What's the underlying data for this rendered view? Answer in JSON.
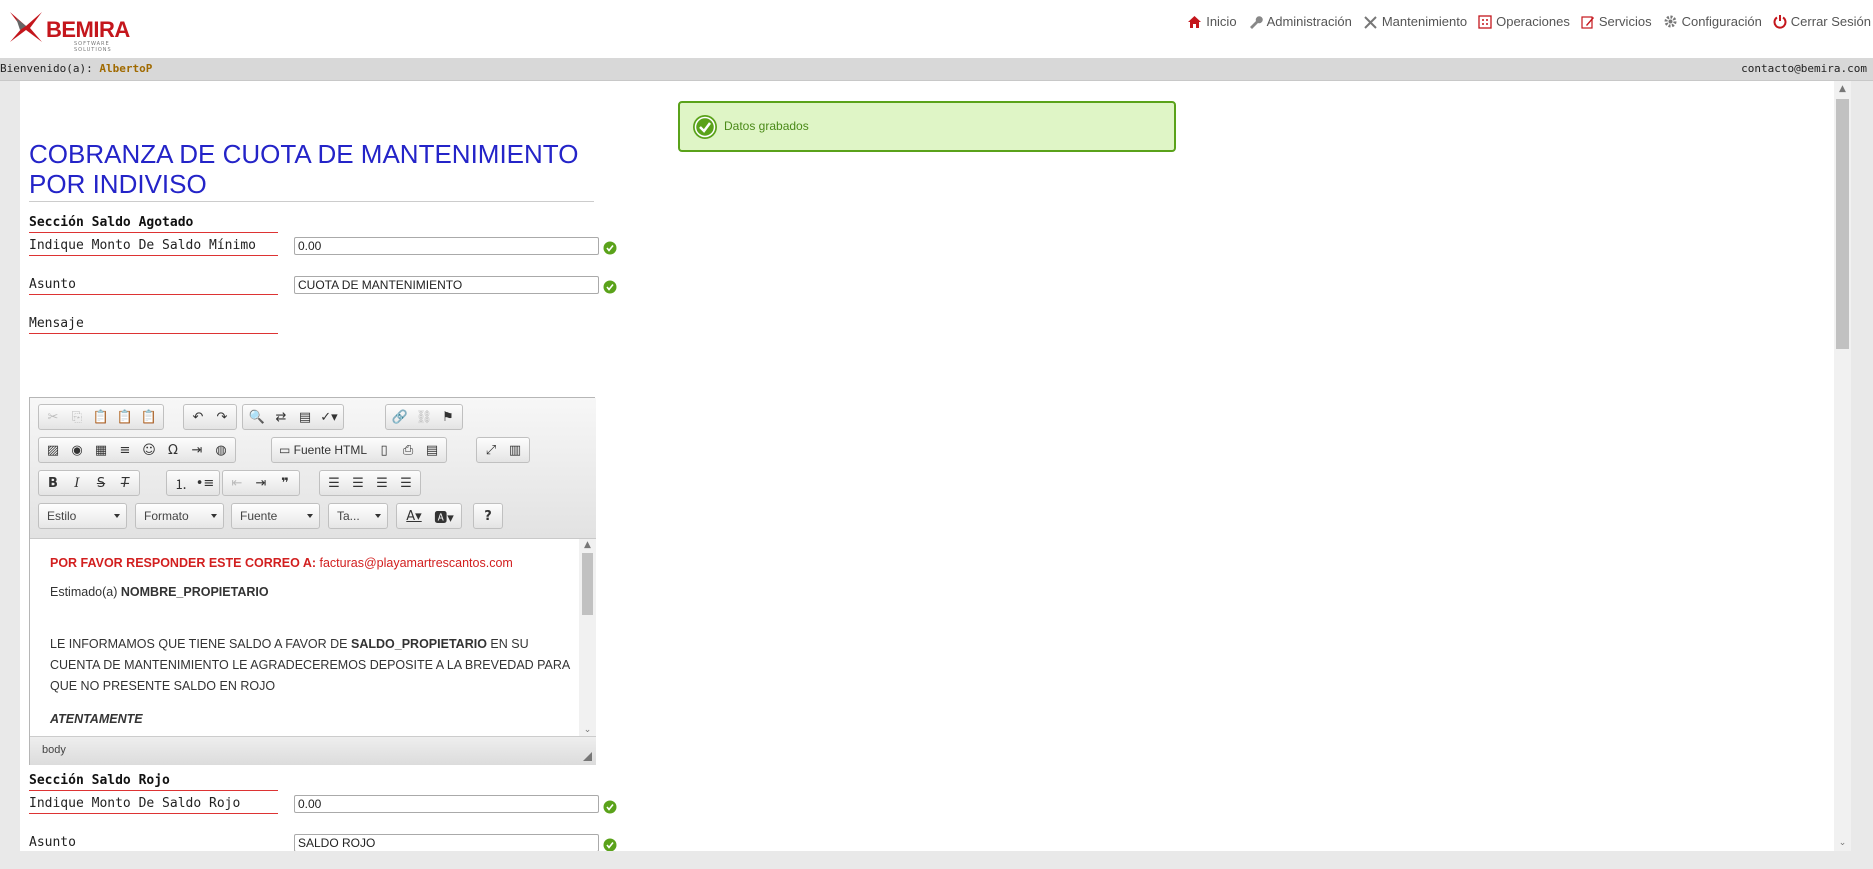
{
  "header": {
    "logo_text": "BEMIRA",
    "logo_subtitle": "SOFTWARE SOLUTIONS",
    "nav": [
      {
        "label": "Inicio",
        "icon": "home-icon"
      },
      {
        "label": "Administración",
        "icon": "wrench-icon"
      },
      {
        "label": "Mantenimiento",
        "icon": "tools-icon"
      },
      {
        "label": "Operaciones",
        "icon": "calculator-icon"
      },
      {
        "label": "Servicios",
        "icon": "edit-icon"
      },
      {
        "label": "Configuración",
        "icon": "gear-icon"
      },
      {
        "label": "Cerrar Sesión",
        "icon": "power-icon"
      }
    ]
  },
  "welcome": {
    "prefix": "Bienvenido(a):",
    "user": "AlbertoP",
    "contact": "contacto@bemira.com"
  },
  "notification": {
    "text": "Datos grabados"
  },
  "page": {
    "title": "COBRANZA DE CUOTA DE MANTENIMIENTO POR INDIVISO"
  },
  "section_agotado": {
    "title": "Sección Saldo Agotado",
    "monto_label": "Indique Monto De Saldo Mínimo",
    "monto_value": "0.00",
    "asunto_label": "Asunto",
    "asunto_value": "CUOTA DE MANTENIMIENTO",
    "mensaje_label": "Mensaje"
  },
  "editor": {
    "fuente_html": "Fuente HTML",
    "combos": {
      "estilo": "Estilo",
      "formato": "Formato",
      "fuente": "Fuente",
      "tamano": "Ta..."
    },
    "help": "?",
    "content": {
      "line1_bold": "POR FAVOR RESPONDER ESTE CORREO A:",
      "line1_email": "facturas@playamartrescantos.com",
      "greeting": "Estimado(a)",
      "owner_var": "NOMBRE_PROPIETARIO",
      "body_pre": "LE INFORMAMOS QUE TIENE SALDO A FAVOR DE",
      "saldo_var": "SALDO_PROPIETARIO",
      "body_post": "EN SU CUENTA DE MANTENIMIENTO LE AGRADECEREMOS DEPOSITE A LA BREVEDAD PARA QUE NO PRESENTE SALDO EN ROJO",
      "closing": "ATENTAMENTE"
    },
    "status_path": "body"
  },
  "section_rojo": {
    "title": "Sección Saldo Rojo",
    "monto_label": "Indique Monto De Saldo Rojo",
    "monto_value": "0.00",
    "asunto_label": "Asunto",
    "asunto_value": "SALDO ROJO"
  },
  "colors": {
    "brand_red": "#c4161c",
    "title_blue": "#2424c8",
    "success_green": "#5aa21a",
    "user_gold": "#a06a00"
  }
}
